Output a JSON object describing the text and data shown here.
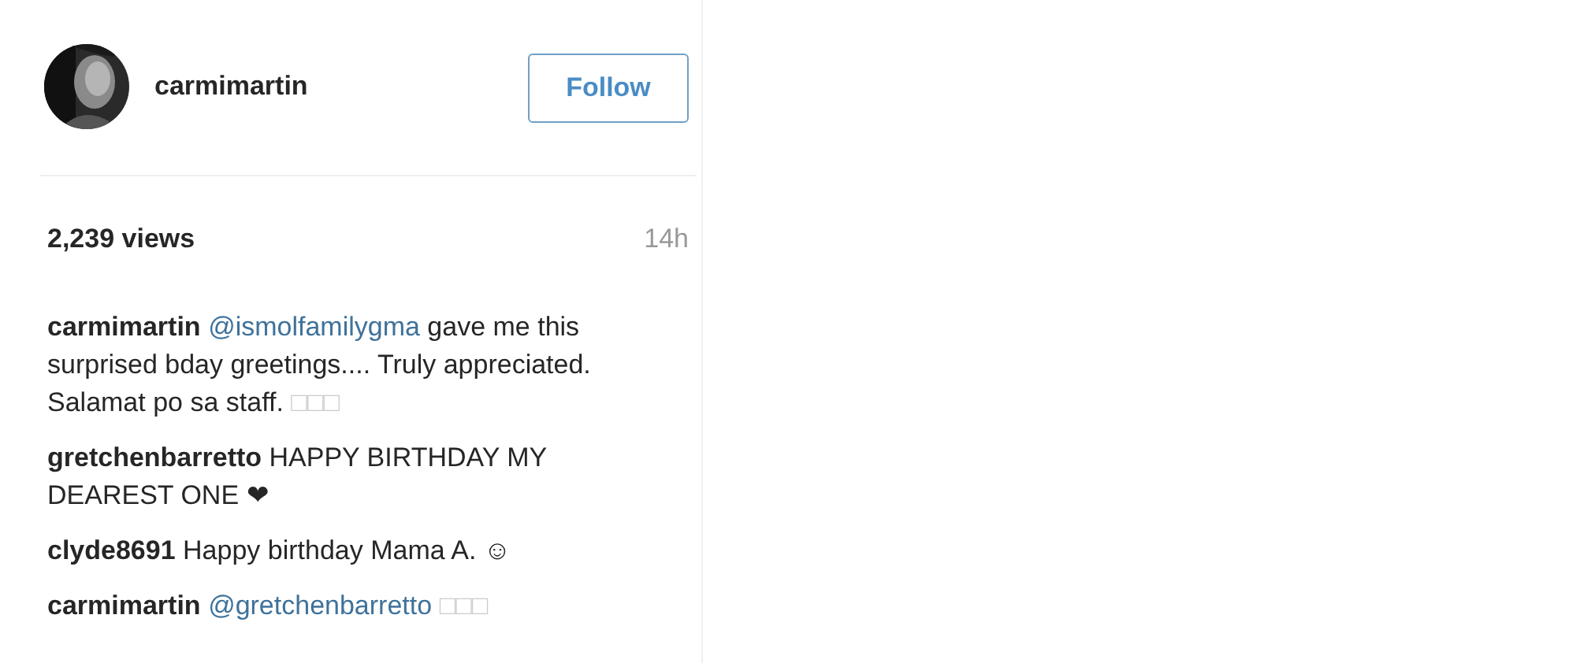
{
  "post_header": {
    "username": "carmimartin",
    "follow_button": "Follow"
  },
  "stats": {
    "views": "2,239 views",
    "time": "14h"
  },
  "comments": [
    {
      "user": "carmimartin",
      "parts": [
        {
          "kind": "mention",
          "text": "@ismolfamilygma"
        },
        {
          "kind": "text",
          "text": " gave me this surprised bday greetings.... Truly appreciated. Salamat po sa staff."
        },
        {
          "kind": "faint",
          "text": "□□□"
        }
      ]
    },
    {
      "user": "gretchenbarretto",
      "parts": [
        {
          "kind": "text",
          "text": " HAPPY BIRTHDAY MY DEAREST ONE ❤"
        }
      ]
    },
    {
      "user": "clyde8691",
      "parts": [
        {
          "kind": "text",
          "text": " Happy birthday Mama A. ☺"
        }
      ]
    },
    {
      "user": "carmimartin",
      "parts": [
        {
          "kind": "mention",
          "text": "@gretchenbarretto"
        },
        {
          "kind": "faint",
          "text": "□□□"
        }
      ]
    }
  ]
}
